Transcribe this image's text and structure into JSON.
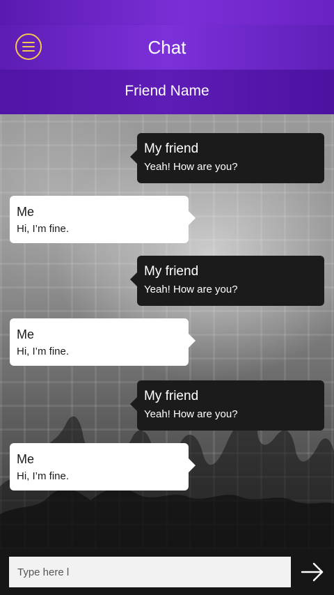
{
  "app": {
    "title": "Chat",
    "accent": "#7c31d9",
    "menu_icon_color": "#f2c94c"
  },
  "conversation": {
    "friend_name": "Friend Name"
  },
  "messages": [
    {
      "from": "friend",
      "sender": "My friend",
      "text": "Yeah! How are you?"
    },
    {
      "from": "me",
      "sender": "Me",
      "text": "Hi, I’m fine."
    },
    {
      "from": "friend",
      "sender": "My friend",
      "text": "Yeah! How are you?"
    },
    {
      "from": "me",
      "sender": "Me",
      "text": "Hi, I’m fine."
    },
    {
      "from": "friend",
      "sender": "My friend",
      "text": "Yeah! How are you?"
    },
    {
      "from": "me",
      "sender": "Me",
      "text": "Hi, I’m fine."
    }
  ],
  "composer": {
    "placeholder": "Type here l",
    "value": "",
    "send_icon": "arrow-right-icon"
  }
}
